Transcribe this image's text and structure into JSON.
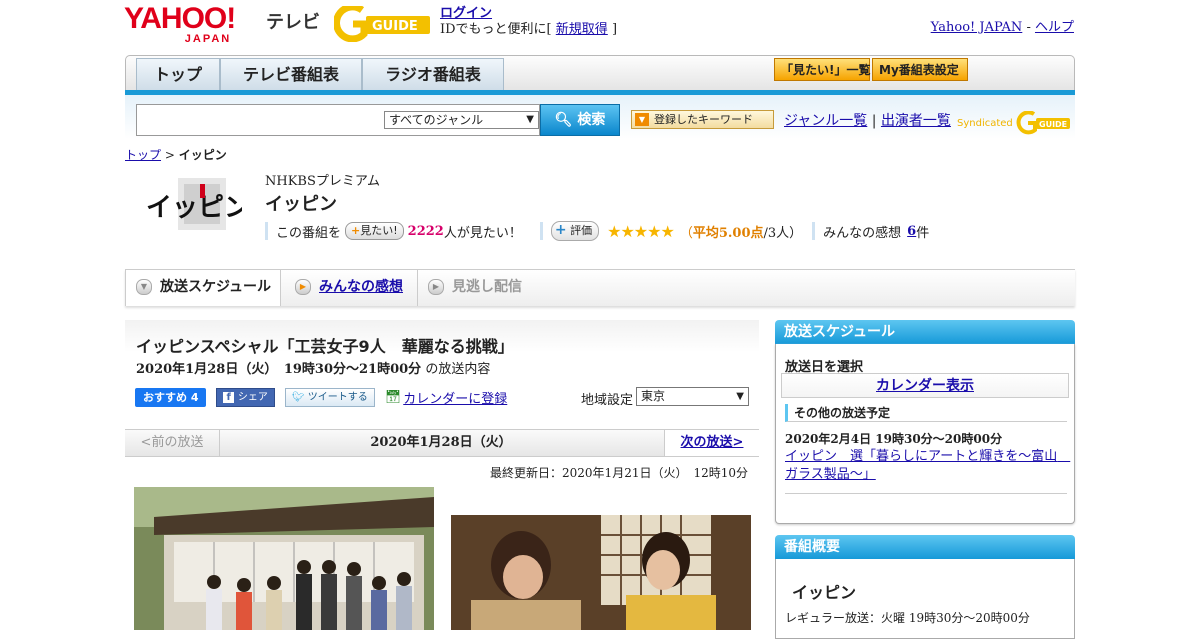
{
  "header": {
    "yahoo_logo": "YAHOO!",
    "yahoo_logo_sub": "JAPAN",
    "service_name": "テレビ",
    "gguide_logo": "G-GUIDE",
    "login_link": "ログイン",
    "login_prompt": "IDでもっと便利に[",
    "signup_link": "新規取得",
    "login_prompt_end": "]",
    "yahoo_japan_link": "Yahoo! JAPAN",
    "separator": "-",
    "help_link": "ヘルプ"
  },
  "nav": {
    "tabs": [
      {
        "label": "トップ"
      },
      {
        "label": "テレビ番組表"
      },
      {
        "label": "ラジオ番組表"
      }
    ],
    "mitai_list_btn": "「見たい!」一覧",
    "my_schedule_btn": "My番組表設定"
  },
  "search": {
    "placeholder": "",
    "genre_selected": "すべてのジャンル",
    "search_btn": "検索",
    "keyword_btn": "登録したキーワード",
    "genre_list_link": "ジャンル一覧",
    "divider": "|",
    "performer_list_link": "出演者一覧",
    "syndicated": "Syndicated"
  },
  "breadcrumb": {
    "home": "トップ",
    "sep": ">",
    "current": "イッピン"
  },
  "program": {
    "logo_text": "イッピン",
    "channel": "NHKBSプレミアム",
    "title": "イッピン",
    "mitai_prefix": "この番組を",
    "mitai_btn": "見たい!",
    "mitai_count": "2222",
    "mitai_suffix": "人が見たい！",
    "hyoka_btn": "評価",
    "stars": "★★★★★",
    "avg_open": "（",
    "avg_label": "平均5.00点",
    "avg_suffix": "/3人）",
    "reviews_label": "みんなの感想",
    "reviews_count": "6",
    "reviews_unit": "件"
  },
  "tabs": {
    "broadcast": "放送スケジュール",
    "reviews": "みんなの感想",
    "streaming": "見逃し配信"
  },
  "episode": {
    "title": "イッピンスペシャル「工芸女子9人　華麗なる挑戦」",
    "datetime": "2020年1月28日（火）　19時30分～21時00分",
    "datetime_suffix": "の放送内容",
    "fb_recommend": "おすすめ 4",
    "fb_share": "シェア",
    "tweet": "ツイートする",
    "calendar_link": "カレンダーに登録",
    "region_label": "地域設定",
    "region_value": "東京",
    "prev_broadcast": "<前の放送",
    "current_date": "2020年1月28日（火）",
    "next_broadcast": "次の放送>",
    "updated": "最終更新日：2020年1月21日（火）　12時10分"
  },
  "sidebar": {
    "schedule_head": "放送スケジュール",
    "pick_date": "放送日を選択",
    "calendar_btn": "カレンダー表示",
    "other_head": "その他の放送予定",
    "other_time": "2020年2月4日 19時30分～20時00分",
    "other_link": "イッピン　選「暮らしにアートと輝きを～富山　ガラス製品～」",
    "overview_head": "番組概要",
    "overview_title": "イッピン",
    "regular": "レギュラー放送：火曜 19時30分～20時00分"
  },
  "colors": {
    "accent_blue": "#1a9ad6",
    "yahoo_red": "#e0001a",
    "mitai_pink": "#d6006a",
    "star_gold": "#f7b500",
    "link": "#1a0dab"
  }
}
